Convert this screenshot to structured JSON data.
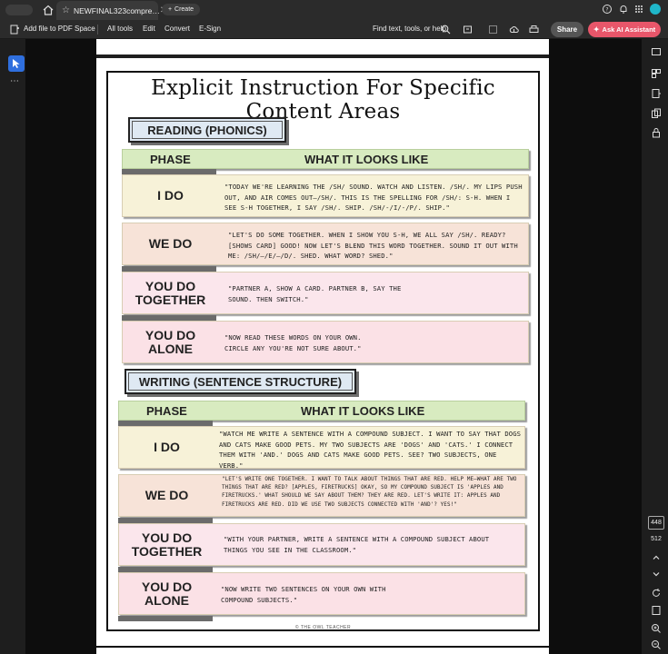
{
  "tabbar": {
    "doc_tab_title": "NEWFINAL323compre…",
    "create_label": "Create"
  },
  "toolbar": {
    "add_file": "Add file to PDF Space",
    "all_tools": "All tools",
    "edit": "Edit",
    "convert": "Convert",
    "esign": "E-Sign",
    "find": "Find text, tools, or help",
    "share": "Share",
    "ai": "Ask AI Assistant"
  },
  "doc": {
    "title": "Explicit Instruction For Specific Content Areas",
    "footer": "© THE OWL TEACHER",
    "sections": [
      {
        "label": "READING (PHONICS)",
        "col_phase": "PHASE",
        "col_what": "WHAT IT LOOKS LIKE",
        "rows": [
          {
            "phase": "I DO",
            "text": "\"Today we're learning the /sh/ sound. Watch and listen. /sh/. My lips push out, and air comes out—/sh/. This is the spelling for /sh/: s-h. When I see s-h together, I say /sh/. Ship. /sh/-/i/-/p/. Ship.\""
          },
          {
            "phase": "WE DO",
            "text": "\"Let's do some together. When I show you s-h, we all say /sh/. Ready? [Shows card] Good! Now let's blend this word together. Sound it out with me: /sh/—/e/—/d/. Shed. What word? Shed.\""
          },
          {
            "phase": "YOU DO TOGETHER",
            "text": "\"Partner A, show a card. Partner B, say the sound. Then switch.\""
          },
          {
            "phase": "YOU DO ALONE",
            "text": "\"Now read these words on your own. Circle any you're not sure about.\""
          }
        ]
      },
      {
        "label": "WRITING (SENTENCE STRUCTURE)",
        "col_phase": "PHASE",
        "col_what": "WHAT IT LOOKS LIKE",
        "rows": [
          {
            "phase": "I DO",
            "text": "\"Watch me write a sentence with a compound subject. I want to say that dogs and cats make good pets. My two subjects are 'dogs' and 'cats.' I connect them with 'and.' Dogs and cats make good pets. See? Two subjects, one verb.\""
          },
          {
            "phase": "WE DO",
            "text": "\"Let's write one together. I want to talk about things that are red. Help me—what are two things that are red? [Apples, firetrucks] Okay, so my compound subject is 'apples and firetrucks.' What should we say about them? They are red. Let's write it: Apples and firetrucks are red. Did we use two subjects connected with 'and'? Yes!\""
          },
          {
            "phase": "YOU DO TOGETHER",
            "text": "\"With your partner, write a sentence with a compound subject about things you see in the classroom.\""
          },
          {
            "phase": "YOU DO ALONE",
            "text": "\"Now write two sentences on your own with compound subjects.\""
          }
        ]
      }
    ]
  },
  "rail": {
    "zoom_value": "448",
    "zoom_label": "512"
  },
  "colors": {
    "i_do": "#f7f2d8",
    "we_do": "#f7e3d8",
    "you_together": "#fbe6ec",
    "you_alone": "#fbe1e6",
    "header_green": "#d8ebc0",
    "ai_button": "#e8566a",
    "select_tool": "#2f6fde"
  }
}
